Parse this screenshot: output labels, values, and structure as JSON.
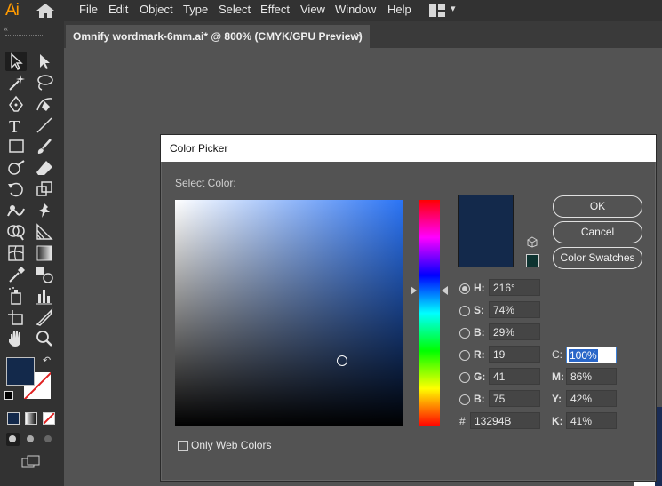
{
  "app": {
    "logo": "Ai"
  },
  "menu": [
    "File",
    "Edit",
    "Object",
    "Type",
    "Select",
    "Effect",
    "View",
    "Window",
    "Help"
  ],
  "document_tab": {
    "title": "Omnify wordmark-6mm.ai* @ 800% (CMYK/GPU Preview)",
    "close": "×"
  },
  "toolbar": {
    "fill_color": "#13294B",
    "stroke_color": "#ffffff"
  },
  "dialog": {
    "title": "Color Picker",
    "select_label": "Select Color:",
    "selected_color": "#13294B",
    "buttons": {
      "ok": "OK",
      "cancel": "Cancel",
      "swatches": "Color Swatches"
    },
    "fields": {
      "h": {
        "label": "H:",
        "value": "216°"
      },
      "s": {
        "label": "S:",
        "value": "74%"
      },
      "b": {
        "label": "B:",
        "value": "29%"
      },
      "r": {
        "label": "R:",
        "value": "19"
      },
      "g": {
        "label": "G:",
        "value": "41"
      },
      "bl": {
        "label": "B:",
        "value": "75"
      },
      "hex": {
        "label": "#",
        "value": "13294B"
      },
      "c": {
        "label": "C:",
        "value": "100%"
      },
      "m": {
        "label": "M:",
        "value": "86%"
      },
      "y": {
        "label": "Y:",
        "value": "42%"
      },
      "k": {
        "label": "K:",
        "value": "41%"
      }
    },
    "web_colors_label": "Only Web Colors"
  }
}
